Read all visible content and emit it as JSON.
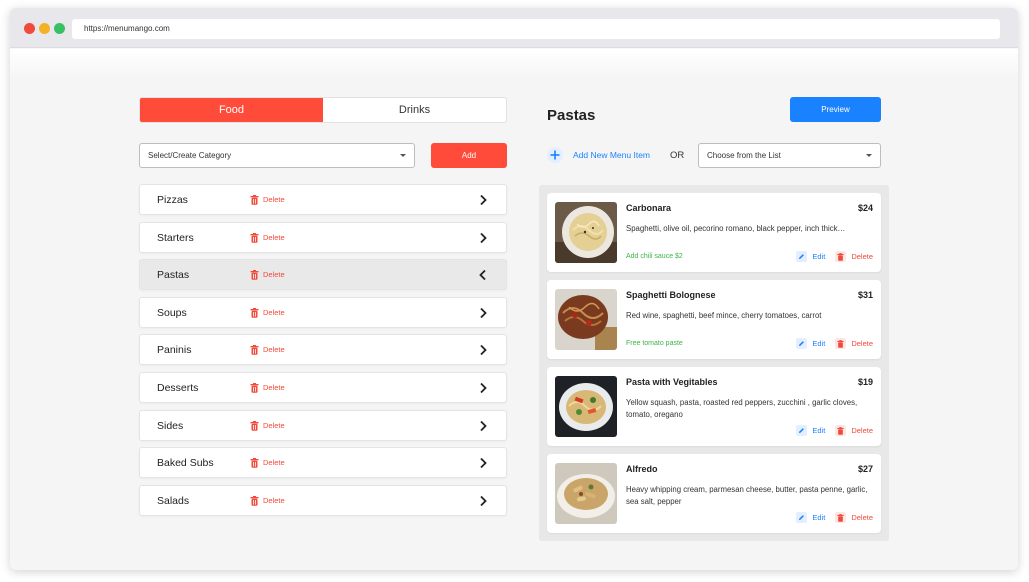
{
  "browser": {
    "url": "https://menumango.com"
  },
  "tabs": {
    "food": "Food",
    "drinks": "Drinks"
  },
  "category_select": {
    "placeholder": "Select/Create Category"
  },
  "add_button": "Add",
  "delete_label": "Delete",
  "categories": [
    {
      "name": "Pizzas",
      "expanded": false
    },
    {
      "name": "Starters",
      "expanded": false
    },
    {
      "name": "Pastas",
      "expanded": true
    },
    {
      "name": "Soups",
      "expanded": false
    },
    {
      "name": "Paninis",
      "expanded": false
    },
    {
      "name": "Desserts",
      "expanded": false
    },
    {
      "name": "Sides",
      "expanded": false
    },
    {
      "name": "Baked Subs",
      "expanded": false
    },
    {
      "name": "Salads",
      "expanded": false
    }
  ],
  "section": {
    "title": "Pastas",
    "preview": "Preview"
  },
  "add_new_item": "Add New Menu Item",
  "or_text": "OR",
  "choose_list": {
    "value": "Choose from the List"
  },
  "edit_label": "Edit",
  "items": [
    {
      "name": "Carbonara",
      "price": "$24",
      "description": "Spaghetti, olive oil, pecorino romano, black pepper, inch thick…",
      "note": "Add chili sauce $2",
      "image": "carbonara-photo"
    },
    {
      "name": "Spaghetti Bolognese",
      "price": "$31",
      "description": "Red wine, spaghetti, beef mince, cherry tomatoes, carrot",
      "note": "Free tomato paste",
      "image": "bolognese-photo"
    },
    {
      "name": "Pasta with Vegitables",
      "price": "$19",
      "description": "Yellow squash, pasta, roasted red peppers, zucchini , garlic cloves, tomato, oregano",
      "note": "",
      "image": "vegetable-pasta-photo"
    },
    {
      "name": "Alfredo",
      "price": "$27",
      "description": "Heavy whipping cream, parmesan cheese, butter, pasta penne, garlic, sea salt, pepper",
      "note": "",
      "image": "alfredo-photo"
    }
  ],
  "colors": {
    "accent_red": "#ff4b3a",
    "accent_blue": "#1a82ff",
    "note_green": "#3cb449"
  }
}
